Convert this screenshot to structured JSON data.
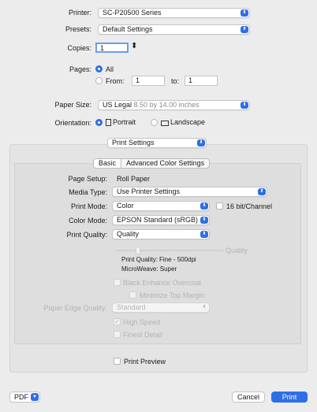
{
  "printer": {
    "label": "Printer:",
    "value": "SC-P20500 Series"
  },
  "presets": {
    "label": "Presets:",
    "value": "Default Settings"
  },
  "copies": {
    "label": "Copies:",
    "value": "1"
  },
  "pages": {
    "label": "Pages:",
    "all_label": "All",
    "from_label": "From:",
    "from_value": "1",
    "to_label": "to:",
    "to_value": "1",
    "selected": "All"
  },
  "paper_size": {
    "label": "Paper Size:",
    "value": "US Legal",
    "dimensions": "8.50 by 14.00 inches"
  },
  "orientation": {
    "label": "Orientation:",
    "portrait_label": "Portrait",
    "landscape_label": "Landscape",
    "selected": "Portrait"
  },
  "panel_menu": {
    "value": "Print Settings"
  },
  "tabs": {
    "basic": "Basic",
    "advanced": "Advanced Color Settings",
    "selected": "Basic"
  },
  "page_setup": {
    "label": "Page Setup:",
    "value": "Roll Paper"
  },
  "media_type": {
    "label": "Media Type:",
    "value": "Use Printer Settings"
  },
  "print_mode": {
    "label": "Print Mode:",
    "value": "Color",
    "bit16_label": "16 bit/Channel",
    "bit16_checked": false
  },
  "color_mode": {
    "label": "Color Mode:",
    "value": "EPSON Standard (sRGB)"
  },
  "print_quality": {
    "label": "Print Quality:",
    "value": "Quality",
    "slider_end": "Quality",
    "detail_quality": "Print Quality: Fine - 500dpi",
    "detail_microweave": "MicroWeave: Super"
  },
  "options": {
    "black_enhance": "Black Enhance Overcoat",
    "minimize_margin": "Minimize Top Margin",
    "paper_edge_label": "Paper Edge Quality:",
    "paper_edge_value": "Standard",
    "high_speed": "High Speed",
    "high_speed_checked": true,
    "finest_detail": "Finest Detail"
  },
  "print_preview": {
    "label": "Print Preview",
    "checked": false
  },
  "footer": {
    "pdf": "PDF",
    "cancel": "Cancel",
    "print": "Print"
  },
  "colors": {
    "accent": "#2f6fe6"
  }
}
